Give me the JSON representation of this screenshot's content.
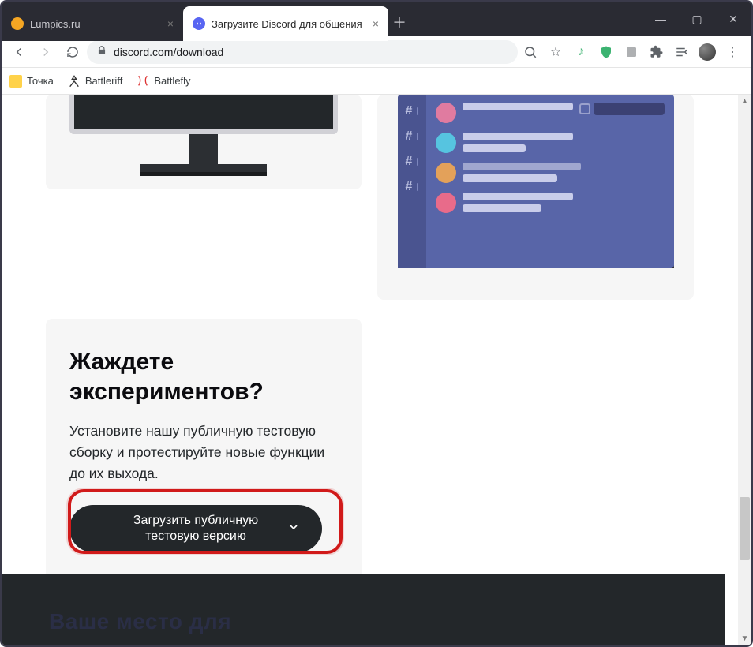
{
  "tabs": [
    {
      "title": "Lumpics.ru"
    },
    {
      "title": "Загрузите Discord для общения"
    }
  ],
  "url": "discord.com/download",
  "bookmarks": [
    {
      "label": "Точка"
    },
    {
      "label": "Battleriff"
    },
    {
      "label": "Battlefly"
    }
  ],
  "card": {
    "heading": "Жаждете экспериментов?",
    "body": "Установите нашу публичную тестовую сборку и протестируйте новые функции до их выхода.",
    "button_line1": "Загрузить публичную",
    "button_line2": "тестовую версию"
  },
  "footer_hint": "Ваше место для"
}
